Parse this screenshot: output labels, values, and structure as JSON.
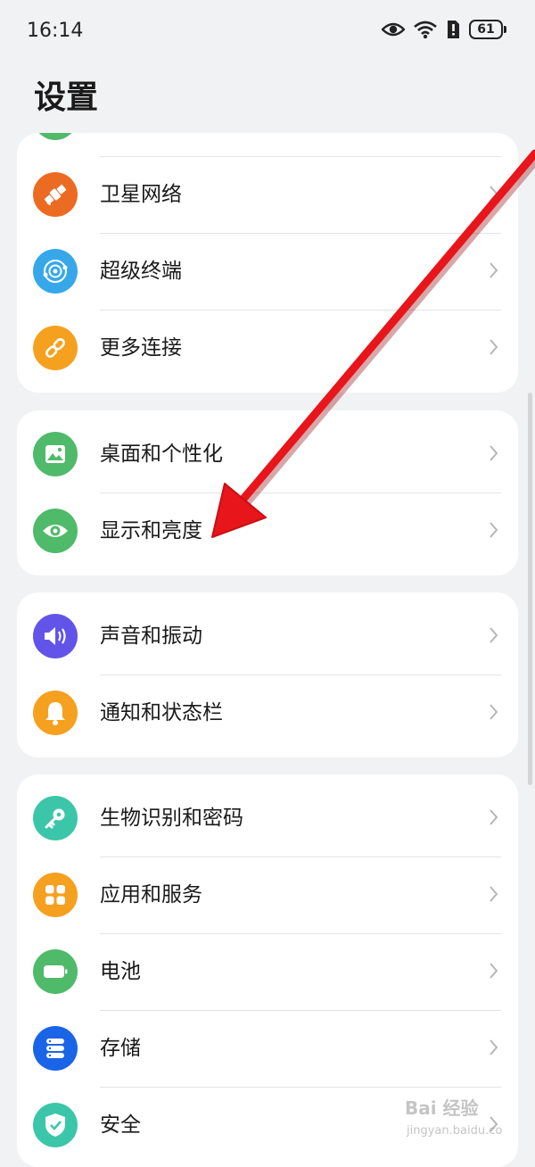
{
  "status_bar": {
    "time": "16:14",
    "battery": "61"
  },
  "page_title": "设置",
  "groups": [
    {
      "items": [
        {
          "label": "卫星网络",
          "icon": "satellite-icon",
          "color": "#ec6b22"
        },
        {
          "label": "超级终端",
          "icon": "super-device-icon",
          "color": "#36a8ea"
        },
        {
          "label": "更多连接",
          "icon": "link-icon",
          "color": "#f6a020"
        }
      ]
    },
    {
      "items": [
        {
          "label": "桌面和个性化",
          "icon": "wallpaper-icon",
          "color": "#4fba6a"
        },
        {
          "label": "显示和亮度",
          "icon": "eye-icon",
          "color": "#4fba6a"
        }
      ]
    },
    {
      "items": [
        {
          "label": "声音和振动",
          "icon": "speaker-icon",
          "color": "#6254e8"
        },
        {
          "label": "通知和状态栏",
          "icon": "bell-icon",
          "color": "#f6a020"
        }
      ]
    },
    {
      "items": [
        {
          "label": "生物识别和密码",
          "icon": "key-icon",
          "color": "#3cc6a9"
        },
        {
          "label": "应用和服务",
          "icon": "apps-icon",
          "color": "#f6a020"
        },
        {
          "label": "电池",
          "icon": "battery-icon",
          "color": "#4fba6a"
        },
        {
          "label": "存储",
          "icon": "storage-icon",
          "color": "#1a64e8"
        },
        {
          "label": "安全",
          "icon": "shield-icon",
          "color": "#3cc6a9"
        }
      ]
    }
  ],
  "annotation": {
    "color": "#e8151b"
  },
  "watermark": {
    "text": "Bai 经验",
    "url": "jingyan.baidu.com"
  }
}
